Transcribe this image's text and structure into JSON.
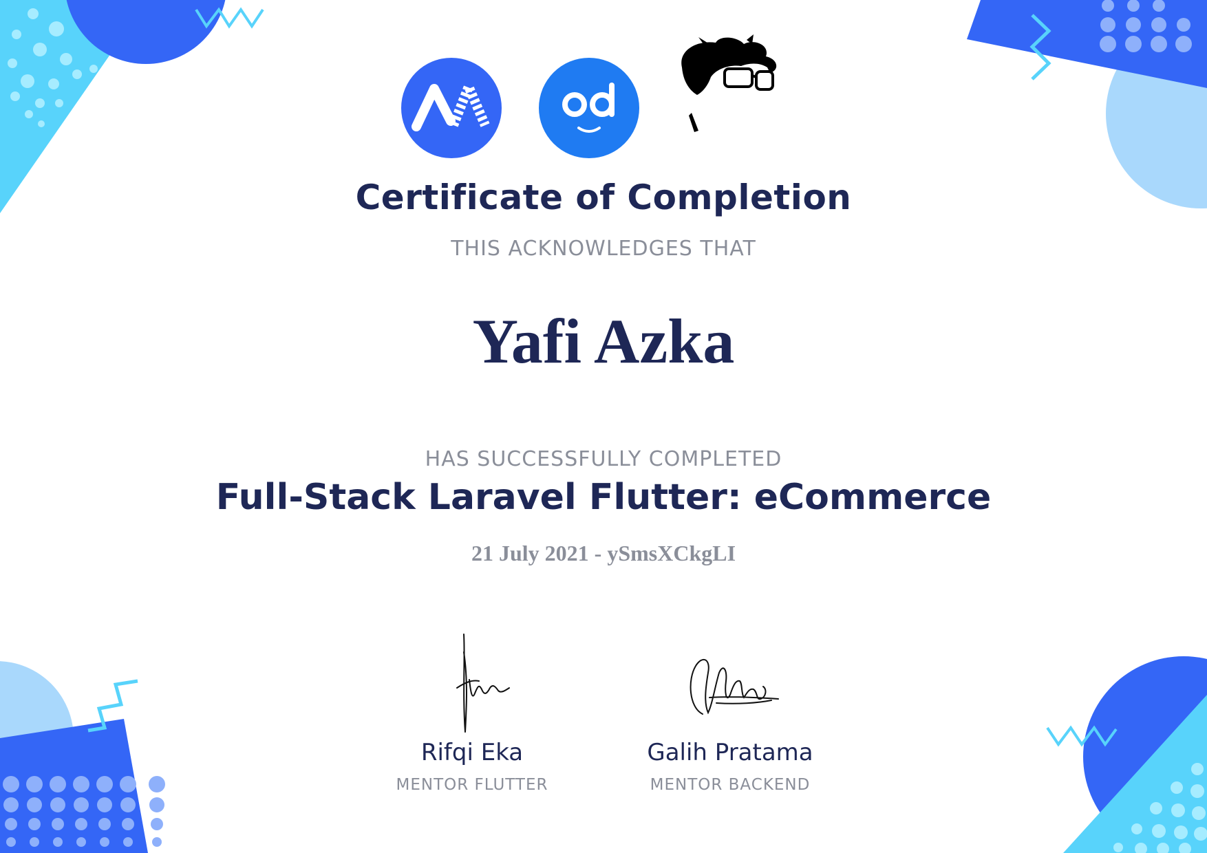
{
  "certificate": {
    "title": "Certificate of Completion",
    "acknowledges": "THIS ACKNOWLEDGES THAT",
    "recipient_name": "Yafi Azka",
    "completed_label": "HAS SUCCESSFULLY COMPLETED",
    "course_name": "Full-Stack Laravel Flutter: eCommerce",
    "date_and_id": "21 July 2021 - ySmsXCkgLI"
  },
  "logos": [
    {
      "icon": "bwa-logo",
      "color": "#3466f6"
    },
    {
      "icon": "od-smiley-logo",
      "color": "#1f7bf2"
    },
    {
      "icon": "face-avatar-logo",
      "color": "#000000"
    }
  ],
  "signers": [
    {
      "name": "Rifqi Eka",
      "role": "MENTOR FLUTTER"
    },
    {
      "name": "Galih Pratama",
      "role": "MENTOR BACKEND"
    }
  ],
  "colors": {
    "navy": "#1e2756",
    "gray": "#8a8e99",
    "royal_blue": "#3466f6",
    "cyan": "#4dd0f9",
    "light_blue": "#a9d8fc"
  }
}
